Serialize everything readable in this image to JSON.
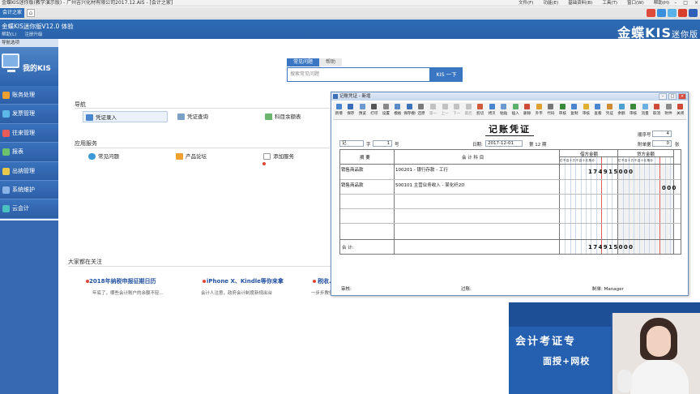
{
  "titlebar": {
    "title": "金蝶KIS迷你版(教学演示版) - 广州吉兴化材有限公司2017.12.AIS - [会计之家]",
    "menus": [
      "文件(F)",
      "功能(E)",
      "基础资料(B)",
      "工具(T)",
      "窗口(W)",
      "帮助(H)"
    ],
    "win_min": "–",
    "win_max": "□",
    "win_close": "×"
  },
  "tabstrip": {
    "tab": "会计之家",
    "home_glyph": "⌂"
  },
  "header": {
    "product": "金蝶KIS迷你版V12.0 体验",
    "sub": [
      "帮助(L)",
      "注册升级"
    ],
    "brand": "金蝶KIS",
    "brand_suffix": "迷你版"
  },
  "sidebar": {
    "nav_title": "导航选项",
    "mykis": "我的KIS",
    "items": [
      {
        "label": "账务处理",
        "color": "#f0a030"
      },
      {
        "label": "发票管理",
        "color": "#5bb8e8"
      },
      {
        "label": "往来管理",
        "color": "#e85b5b"
      },
      {
        "label": "报表",
        "color": "#6cc26c"
      },
      {
        "label": "出纳管理",
        "color": "#e8c84a"
      },
      {
        "label": "系统维护",
        "color": "#8ab4e8"
      },
      {
        "label": "云会计",
        "color": "#4ac0c0"
      }
    ]
  },
  "search": {
    "tab_active": "常见问题",
    "tab_other": "帮助",
    "placeholder": "搜索常见问题",
    "button": "KIS 一下"
  },
  "nav_section": {
    "title": "导航",
    "links": [
      "凭证录入",
      "凭证查询",
      "科目余额表"
    ]
  },
  "app_section": {
    "title": "应用服务",
    "links": [
      "常见问题",
      "产品论坛",
      "添加服务"
    ]
  },
  "news_section": {
    "title": "大家都在关注",
    "items": [
      {
        "title": "2018年纳税申报征期日历",
        "sub": "年底了，哪些会计账户的余额不轻..."
      },
      {
        "title": "iPhone X、Kindle等你来拿",
        "sub": "会计人注意，政府会计制度新规出台"
      },
      {
        "title": "税收...",
        "sub": "一步步教你做好年末结账..."
      }
    ]
  },
  "ad": {
    "line1": "会计考证专",
    "line2": "面授+网校"
  },
  "voucher": {
    "window_title": "记账凭证 - 新增",
    "toolbar": [
      "新增",
      "保存",
      "预览",
      "打印",
      "设置",
      "模板",
      "保存模板",
      "还原",
      "第一",
      "上一",
      "下一",
      "最后",
      "剪切",
      "拷贝",
      "粘贴",
      "插入",
      "删除",
      "外币",
      "代码",
      "审核",
      "复制",
      "审核",
      "查看",
      "凭证",
      "余额",
      "审核",
      "流量",
      "取消",
      "附件",
      "关闭"
    ],
    "dim_from": 8,
    "dim_to": 11,
    "title": "记账凭证",
    "zi_label": "记",
    "zi_word": "字",
    "zi_no": "1",
    "hao": "号",
    "date_label": "日期:",
    "date": "2017-12-01",
    "period": "第 12 期",
    "seq_label": "顺序号",
    "seq": "4",
    "attach_label": "附单据",
    "attach": "0",
    "attach_unit": "张",
    "col_summary": "摘 要",
    "col_account": "会 计 科 目",
    "col_debit": "借方金额",
    "col_credit": "贷方金额",
    "digits_header": "亿千百十万千百十元角分",
    "rows": [
      {
        "summary": "销售商品款",
        "account": "100201 - 银行存款 - 工行",
        "debit": "174915000",
        "credit": ""
      },
      {
        "summary": "销售商品款",
        "account": "500101 主营业务收入 - 某化纤2D",
        "debit": "",
        "credit": "000"
      }
    ],
    "total_label": "合 计:",
    "total_debit": "174915000",
    "footer": {
      "review": "审核:",
      "post": "过账:",
      "maker": "制单: Manager"
    }
  }
}
